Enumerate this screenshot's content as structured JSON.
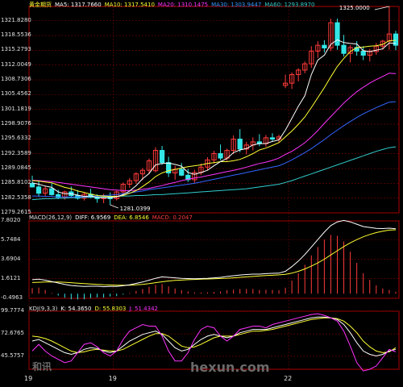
{
  "colors": {
    "bg": "#000000",
    "grid": "#7a0000",
    "axis": "#b00000",
    "text": "#e0e0e0",
    "up": "#ff3b3b",
    "down": "#33e6e6",
    "ma5": "#ffffff",
    "ma10": "#ffff33",
    "ma20": "#ff33ff",
    "ma30": "#3366ff",
    "ma60": "#33cccc",
    "diff": "#ffffff",
    "dea": "#ffff33",
    "macd_pos": "#ff3b3b",
    "macd_neg": "#33e6e6",
    "k": "#ffffff",
    "d": "#ffff33",
    "j": "#ff33ff"
  },
  "legend_price": {
    "instrument": "黄金期货",
    "ma5": "MA5: 1317.7660",
    "ma10": "MA10: 1317.5410",
    "ma20": "MA20: 1310.1475",
    "ma30": "MA30: 1303.9447",
    "ma60": "MA60: 1293.8970"
  },
  "legend_macd": {
    "title": "MACD(26,12,9)",
    "diff": "DIFF: 6.9569",
    "dea": "DEA: 6.8546",
    "macd": "MACD: 0.2047"
  },
  "legend_kdj": {
    "title": "KDJ(9,3,3)",
    "k": "K: 54.3650",
    "d": "D: 55.8303",
    "j": "J: 51.4342"
  },
  "watermark": {
    "brand": "和讯",
    "url": "hexun.com"
  },
  "chart_data": [
    {
      "type": "candlestick",
      "ylim": [
        1279.2615,
        1325.0
      ],
      "yticks": [
        "1321.8280",
        "1318.5536",
        "1315.2793",
        "1312.0049",
        "1308.7306",
        "1305.4562",
        "1301.1819",
        "1298.9076",
        "1295.6332",
        "1292.3589",
        "1289.0845",
        "1285.8102",
        "1282.5358",
        "1279.2615"
      ],
      "ytick_values": [
        1321.828,
        1318.5536,
        1315.2793,
        1312.0049,
        1308.7306,
        1305.4562,
        1302.1819,
        1298.9076,
        1295.6332,
        1292.3589,
        1289.0845,
        1285.8102,
        1282.5358,
        1279.2615
      ],
      "xlabels": [
        "19",
        "19",
        "22"
      ],
      "xlabel_index": [
        0,
        13,
        40
      ],
      "annotations": [
        {
          "text": "1325.0000",
          "index": 55,
          "value": 1325.0
        },
        {
          "text": "1281.0399",
          "index": 12,
          "value": 1281.04
        }
      ],
      "ohlc": [
        [
          1285.8,
          1287.5,
          1284.9,
          1285.0
        ],
        [
          1285.0,
          1286.5,
          1282.8,
          1283.6
        ],
        [
          1283.6,
          1285.2,
          1282.9,
          1284.6
        ],
        [
          1284.6,
          1285.8,
          1283.1,
          1283.3
        ],
        [
          1283.3,
          1284.4,
          1282.3,
          1282.7
        ],
        [
          1282.7,
          1284.2,
          1282.2,
          1283.9
        ],
        [
          1283.9,
          1285.1,
          1282.7,
          1283.1
        ],
        [
          1283.1,
          1284.3,
          1282.2,
          1282.5
        ],
        [
          1282.5,
          1283.8,
          1282.0,
          1283.4
        ],
        [
          1283.4,
          1284.6,
          1282.5,
          1282.7
        ],
        [
          1282.7,
          1283.4,
          1281.5,
          1282.4
        ],
        [
          1282.4,
          1283.5,
          1281.4,
          1282.9
        ],
        [
          1282.9,
          1283.8,
          1281.04,
          1282.4
        ],
        [
          1282.4,
          1284.2,
          1282.0,
          1283.9
        ],
        [
          1283.9,
          1286.0,
          1283.3,
          1285.6
        ],
        [
          1285.6,
          1287.0,
          1284.8,
          1286.4
        ],
        [
          1286.4,
          1288.3,
          1285.7,
          1287.9
        ],
        [
          1287.9,
          1289.2,
          1286.5,
          1288.7
        ],
        [
          1288.7,
          1291.3,
          1287.8,
          1290.8
        ],
        [
          1288.6,
          1293.8,
          1288.2,
          1293.1
        ],
        [
          1293.1,
          1294.1,
          1289.9,
          1290.4
        ],
        [
          1290.4,
          1291.7,
          1287.2,
          1288.1
        ],
        [
          1288.1,
          1289.7,
          1286.6,
          1288.9
        ],
        [
          1288.9,
          1290.3,
          1287.4,
          1287.6
        ],
        [
          1287.6,
          1289.0,
          1286.1,
          1286.6
        ],
        [
          1286.6,
          1288.8,
          1285.9,
          1288.2
        ],
        [
          1288.2,
          1290.2,
          1287.6,
          1289.4
        ],
        [
          1289.4,
          1291.6,
          1288.7,
          1291.0
        ],
        [
          1291.0,
          1293.0,
          1290.2,
          1292.4
        ],
        [
          1292.4,
          1294.4,
          1290.9,
          1291.4
        ],
        [
          1291.4,
          1293.5,
          1290.8,
          1293.1
        ],
        [
          1293.1,
          1296.4,
          1292.3,
          1295.6
        ],
        [
          1295.6,
          1297.8,
          1292.7,
          1293.4
        ],
        [
          1293.4,
          1295.0,
          1292.2,
          1294.3
        ],
        [
          1294.3,
          1296.0,
          1293.1,
          1295.0
        ],
        [
          1295.0,
          1296.7,
          1294.0,
          1294.6
        ],
        [
          1294.6,
          1296.5,
          1293.9,
          1295.9
        ],
        [
          1295.9,
          1296.9,
          1295.0,
          1295.6
        ],
        [
          1295.6,
          1296.6,
          1294.8,
          1296.1
        ],
        [
          1307.5,
          1309.9,
          1306.9,
          1308.0
        ],
        [
          1308.0,
          1310.4,
          1306.7,
          1309.9
        ],
        [
          1309.9,
          1311.3,
          1308.4,
          1310.9
        ],
        [
          1310.9,
          1312.8,
          1310.2,
          1312.3
        ],
        [
          1312.3,
          1316.2,
          1311.4,
          1315.1
        ],
        [
          1315.1,
          1317.3,
          1313.6,
          1316.4
        ],
        [
          1316.4,
          1317.5,
          1314.8,
          1315.8
        ],
        [
          1315.8,
          1322.3,
          1315.1,
          1321.4
        ],
        [
          1321.4,
          1322.3,
          1315.4,
          1316.4
        ],
        [
          1316.4,
          1318.7,
          1313.9,
          1314.6
        ],
        [
          1314.6,
          1316.4,
          1312.6,
          1315.9
        ],
        [
          1315.9,
          1317.3,
          1314.1,
          1315.1
        ],
        [
          1315.1,
          1316.2,
          1313.1,
          1314.2
        ],
        [
          1314.2,
          1315.6,
          1312.8,
          1315.0
        ],
        [
          1315.0,
          1316.9,
          1314.3,
          1316.2
        ],
        [
          1316.2,
          1317.6,
          1315.4,
          1317.3
        ],
        [
          1317.3,
          1325.0,
          1315.4,
          1318.9
        ],
        [
          1318.9,
          1319.6,
          1315.3,
          1316.4
        ]
      ],
      "ma5": [
        1285.9,
        1285.6,
        1285.2,
        1284.9,
        1283.9,
        1283.5,
        1283.5,
        1283.2,
        1282.9,
        1283.0,
        1282.7,
        1282.6,
        1282.6,
        1282.8,
        1283.3,
        1284.1,
        1285.3,
        1286.8,
        1288.0,
        1289.9,
        1290.2,
        1290.3,
        1290.0,
        1289.6,
        1288.2,
        1287.8,
        1288.2,
        1288.7,
        1289.7,
        1290.6,
        1291.3,
        1292.6,
        1293.2,
        1293.5,
        1294.3,
        1294.6,
        1294.6,
        1295.1,
        1295.4,
        1297.6,
        1300.2,
        1302.9,
        1305.2,
        1309.9,
        1313.1,
        1314.2,
        1316.6,
        1317.6,
        1317.0,
        1316.8,
        1316.7,
        1315.2,
        1315.0,
        1315.3,
        1315.6,
        1316.9,
        1316.8
      ],
      "ma10": [
        1286.4,
        1286.3,
        1286.1,
        1285.9,
        1285.4,
        1284.9,
        1284.6,
        1284.1,
        1283.8,
        1283.4,
        1283.1,
        1283.0,
        1282.9,
        1282.9,
        1283.1,
        1283.6,
        1284.2,
        1285.1,
        1286.1,
        1287.3,
        1288.1,
        1288.6,
        1288.9,
        1289.2,
        1289.5,
        1289.7,
        1289.9,
        1290.2,
        1290.4,
        1290.6,
        1290.6,
        1290.8,
        1291.1,
        1291.7,
        1292.4,
        1293.2,
        1293.6,
        1294.2,
        1294.8,
        1296.1,
        1297.4,
        1298.9,
        1300.5,
        1302.6,
        1304.8,
        1307.0,
        1309.4,
        1311.7,
        1313.5,
        1315.0,
        1315.9,
        1316.0,
        1316.2,
        1316.3,
        1316.6,
        1317.4,
        1317.5
      ],
      "ma20": [
        1286.5,
        1286.4,
        1286.3,
        1286.2,
        1286.0,
        1285.8,
        1285.6,
        1285.4,
        1285.2,
        1285.0,
        1284.8,
        1284.6,
        1284.4,
        1284.3,
        1284.2,
        1284.2,
        1284.3,
        1284.5,
        1284.7,
        1285.0,
        1285.3,
        1285.7,
        1286.0,
        1286.4,
        1286.7,
        1287.0,
        1287.2,
        1287.5,
        1287.8,
        1288.1,
        1288.4,
        1288.7,
        1289.0,
        1289.4,
        1289.8,
        1290.2,
        1290.5,
        1290.9,
        1291.4,
        1292.2,
        1292.9,
        1293.8,
        1294.8,
        1296.1,
        1297.5,
        1299.1,
        1300.6,
        1302.1,
        1303.6,
        1304.9,
        1306.1,
        1307.1,
        1308.0,
        1308.8,
        1309.5,
        1310.2,
        1310.1
      ],
      "ma30": [
        1283.0,
        1283.0,
        1282.9,
        1282.9,
        1282.8,
        1282.8,
        1282.8,
        1282.8,
        1282.8,
        1282.9,
        1283.0,
        1283.1,
        1283.2,
        1283.3,
        1283.5,
        1283.7,
        1283.9,
        1284.1,
        1284.4,
        1284.6,
        1284.8,
        1285.0,
        1285.2,
        1285.4,
        1285.6,
        1285.8,
        1286.1,
        1286.4,
        1286.7,
        1287.0,
        1287.3,
        1287.6,
        1287.9,
        1288.2,
        1288.5,
        1288.8,
        1289.1,
        1289.4,
        1289.7,
        1290.3,
        1291.0,
        1291.8,
        1292.6,
        1293.5,
        1294.5,
        1295.5,
        1296.6,
        1297.6,
        1298.6,
        1299.5,
        1300.4,
        1301.2,
        1301.9,
        1302.6,
        1303.2,
        1303.8,
        1303.9
      ],
      "ma60": [
        1282.2,
        1282.3,
        1282.4,
        1282.4,
        1282.5,
        1282.5,
        1282.6,
        1282.6,
        1282.7,
        1282.7,
        1282.8,
        1282.8,
        1282.9,
        1282.9,
        1283.0,
        1283.0,
        1283.1,
        1283.1,
        1283.2,
        1283.3,
        1283.3,
        1283.4,
        1283.5,
        1283.6,
        1283.7,
        1283.8,
        1283.9,
        1284.0,
        1284.1,
        1284.2,
        1284.3,
        1284.4,
        1284.5,
        1284.6,
        1284.8,
        1285.0,
        1285.2,
        1285.4,
        1285.6,
        1286.0,
        1286.4,
        1286.9,
        1287.4,
        1287.9,
        1288.4,
        1288.9,
        1289.4,
        1289.9,
        1290.4,
        1290.9,
        1291.4,
        1291.9,
        1292.4,
        1292.9,
        1293.3,
        1293.7,
        1293.9
      ]
    },
    {
      "type": "macd",
      "ylim": [
        -0.4963,
        7.802
      ],
      "yticks": [
        "7.8020",
        "5.7484",
        "3.6904",
        "1.6121",
        "-0.4963"
      ],
      "ytick_values": [
        7.802,
        5.7484,
        3.6904,
        1.6121,
        -0.4963
      ],
      "diff": [
        1.5,
        1.55,
        1.45,
        1.3,
        1.15,
        1.0,
        0.88,
        0.82,
        0.78,
        0.8,
        0.8,
        0.75,
        0.78,
        0.78,
        0.85,
        0.95,
        1.1,
        1.25,
        1.45,
        1.65,
        1.8,
        1.75,
        1.7,
        1.65,
        1.62,
        1.6,
        1.62,
        1.65,
        1.7,
        1.75,
        1.85,
        1.92,
        2.0,
        2.05,
        2.1,
        2.1,
        2.15,
        2.18,
        2.2,
        2.4,
        2.9,
        3.5,
        4.2,
        5.0,
        5.8,
        6.6,
        7.3,
        7.7,
        7.85,
        7.7,
        7.45,
        7.2,
        7.1,
        7.0,
        6.98,
        7.02,
        6.96
      ],
      "dea": [
        1.2,
        1.22,
        1.25,
        1.26,
        1.25,
        1.22,
        1.18,
        1.13,
        1.08,
        1.03,
        1.0,
        0.96,
        0.93,
        0.91,
        0.9,
        0.91,
        0.95,
        1.0,
        1.08,
        1.18,
        1.28,
        1.36,
        1.42,
        1.46,
        1.5,
        1.53,
        1.56,
        1.58,
        1.6,
        1.63,
        1.66,
        1.7,
        1.75,
        1.8,
        1.85,
        1.9,
        1.94,
        1.98,
        2.02,
        2.08,
        2.2,
        2.4,
        2.65,
        2.95,
        3.3,
        3.7,
        4.15,
        4.6,
        5.05,
        5.45,
        5.8,
        6.1,
        6.35,
        6.55,
        6.7,
        6.82,
        6.85
      ],
      "hist": [
        0.6,
        0.66,
        0.4,
        0.08,
        -0.2,
        -0.44,
        -0.6,
        -0.62,
        -0.6,
        -0.46,
        -0.4,
        -0.42,
        -0.3,
        -0.26,
        -0.1,
        0.08,
        0.3,
        0.5,
        0.74,
        0.94,
        1.04,
        0.78,
        0.56,
        0.38,
        0.24,
        0.14,
        0.12,
        0.14,
        0.2,
        0.24,
        0.38,
        0.44,
        0.5,
        0.5,
        0.5,
        0.4,
        0.42,
        0.4,
        0.36,
        0.64,
        1.4,
        2.2,
        3.1,
        4.1,
        5.0,
        5.8,
        6.3,
        6.2,
        5.6,
        4.5,
        3.3,
        2.2,
        1.5,
        0.9,
        0.56,
        0.4,
        0.2
      ]
    },
    {
      "type": "kdj",
      "ylim": [
        30.0,
        100.0
      ],
      "yticks": [
        "99.7774",
        "72.6765",
        "45.5757"
      ],
      "ytick_values": [
        99.7774,
        72.6765,
        45.5757
      ],
      "k": [
        64,
        66,
        62,
        58,
        54,
        50,
        48,
        50,
        54,
        56,
        55,
        52,
        50,
        52,
        58,
        64,
        68,
        72,
        74,
        76,
        72,
        64,
        56,
        52,
        54,
        60,
        66,
        70,
        72,
        70,
        68,
        70,
        74,
        76,
        78,
        78,
        78,
        80,
        82,
        84,
        86,
        88,
        90,
        92,
        93,
        93,
        92,
        90,
        84,
        74,
        62,
        52,
        48,
        46,
        48,
        52,
        54
      ],
      "d": [
        70,
        69,
        67,
        64,
        60,
        56,
        52,
        50,
        51,
        53,
        54,
        53,
        52,
        52,
        54,
        58,
        62,
        66,
        70,
        73,
        73,
        70,
        64,
        58,
        56,
        57,
        60,
        64,
        68,
        70,
        70,
        70,
        72,
        74,
        76,
        76,
        77,
        78,
        80,
        82,
        84,
        86,
        88,
        90,
        91,
        92,
        92,
        91,
        88,
        82,
        74,
        64,
        57,
        52,
        50,
        51,
        56
      ],
      "j": [
        52,
        60,
        52,
        46,
        42,
        38,
        40,
        50,
        60,
        62,
        57,
        50,
        46,
        52,
        66,
        76,
        80,
        84,
        82,
        82,
        70,
        52,
        40,
        40,
        50,
        66,
        78,
        82,
        80,
        70,
        64,
        70,
        78,
        80,
        82,
        82,
        80,
        84,
        86,
        88,
        90,
        92,
        94,
        96,
        97,
        95,
        92,
        88,
        76,
        58,
        38,
        28,
        30,
        34,
        44,
        54,
        51
      ]
    }
  ]
}
